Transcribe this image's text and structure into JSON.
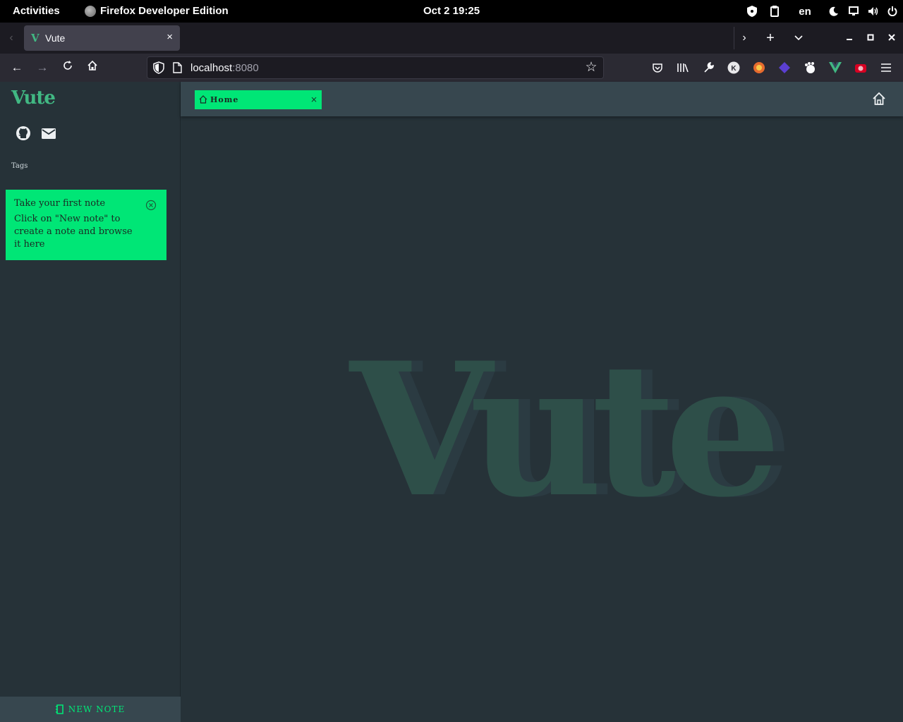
{
  "topbar": {
    "activities": "Activities",
    "app_name": "Firefox Developer Edition",
    "clock": "Oct 2  19:25",
    "language": "en"
  },
  "browser": {
    "tab_title": "Vute",
    "tab_close": "×",
    "url_host": "localhost",
    "url_port": ":8080"
  },
  "sidebar": {
    "logo": "Vute",
    "tags_label": "Tags",
    "notice": {
      "title": "Take your first note",
      "body": "Click on \"New note\" to create a note and browse it here"
    },
    "new_note_label": "NEW NOTE"
  },
  "main": {
    "tab_label": "Home",
    "tab_close": "×",
    "watermark": "Vute"
  },
  "colors": {
    "accent": "#00e676",
    "brand": "#41b883",
    "sidebar_bg": "#263238",
    "header_bg": "#37474f"
  }
}
